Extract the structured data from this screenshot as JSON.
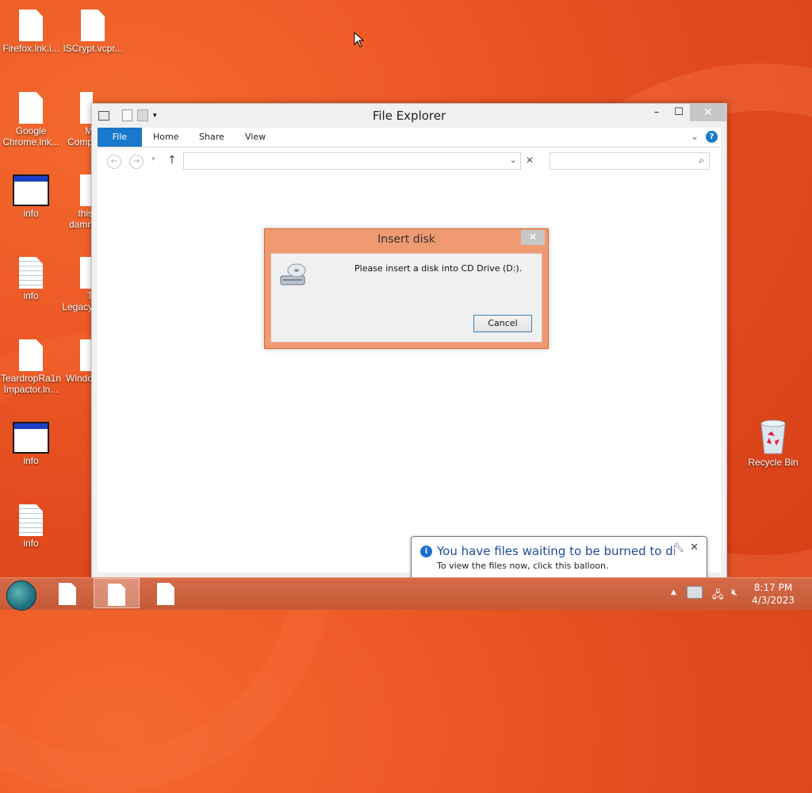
{
  "desktop": {
    "icons": [
      {
        "label": "Firefox.lnk.i..."
      },
      {
        "label": "ISCrypt.vcpr..."
      },
      {
        "label": "Google\nChrome.lnk..."
      },
      {
        "label": "M\nComp"
      },
      {
        "label": "info"
      },
      {
        "label": "this\ndamn"
      },
      {
        "label": "info"
      },
      {
        "label": "T\nLegacy"
      },
      {
        "label": "TeardropRa1n\nImpactor.ln..."
      },
      {
        "label": "Windo"
      },
      {
        "label": "info"
      },
      {
        "label": "info"
      },
      {
        "label": "Recycle Bin"
      }
    ]
  },
  "explorer": {
    "title": "File Explorer",
    "tabs": [
      "File",
      "Home",
      "Share",
      "View"
    ],
    "address_value": "",
    "search_placeholder": ""
  },
  "dialog": {
    "title": "Insert disk",
    "message": "Please insert a disk into CD Drive (D:).",
    "cancel_label": "Cancel"
  },
  "balloon": {
    "title": "You have files waiting to be burned to disc",
    "text": "To view the files now, click this balloon."
  },
  "clock": {
    "time": "8:17 PM",
    "date": "4/3/2023"
  },
  "colors": {
    "desktop": "#e24a1e",
    "accent": "#1979ca",
    "dialog_frame": "#ef9a71"
  }
}
